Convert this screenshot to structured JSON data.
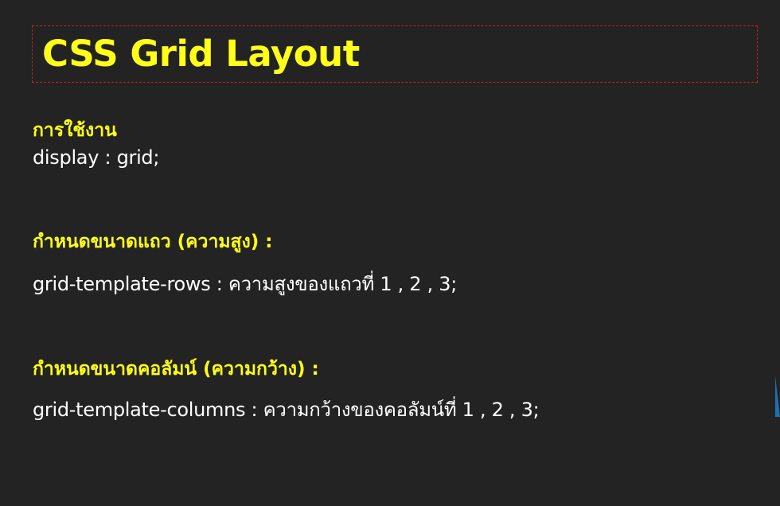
{
  "title": "CSS Grid Layout",
  "sections": [
    {
      "heading": "การใช้งาน",
      "code": "display : grid;"
    },
    {
      "heading": "กำหนดขนาดแถว (ความสูง) :",
      "code": "grid-template-rows : ความสูงของแถวที่ 1 , 2 , 3;"
    },
    {
      "heading": "กำหนดขนาดคอลัมน์ (ความกว้าง) :",
      "code": "grid-template-columns : ความกว้างของคอลัมน์ที่ 1 , 2 , 3;"
    }
  ],
  "colors": {
    "background": "#232323",
    "heading": "#ffff17",
    "text": "#ffffff",
    "title_border": "#c0202a",
    "edge_accent": "#1f6fb5"
  }
}
